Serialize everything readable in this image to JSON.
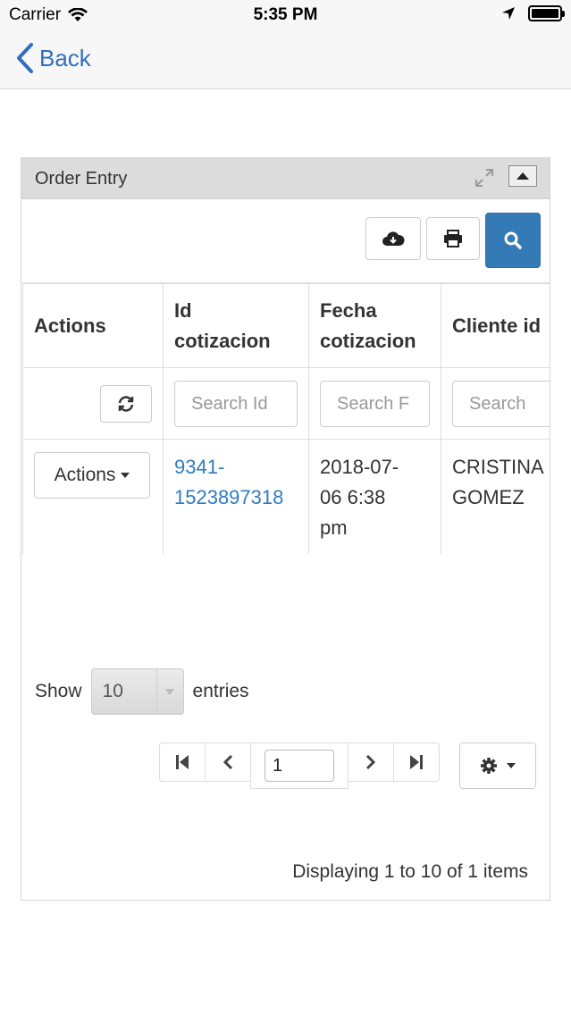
{
  "status_bar": {
    "carrier": "Carrier",
    "time": "5:35 PM"
  },
  "nav": {
    "back_label": "Back"
  },
  "panel": {
    "title": "Order Entry"
  },
  "table": {
    "headers": {
      "actions": "Actions",
      "id_line1": "Id",
      "id_line2": "cotizacion",
      "fecha_line1": "Fecha",
      "fecha_line2": "cotizacion",
      "cliente": "Cliente id"
    },
    "filters": {
      "id_placeholder": "Search Id",
      "fecha_placeholder": "Search F",
      "cliente_placeholder": "Search"
    },
    "rows": [
      {
        "actions_label": "Actions",
        "id_line1": "9341-",
        "id_line2": "1523897318",
        "fecha_line1": "2018-07-",
        "fecha_line2": "06 6:38",
        "fecha_line3": "pm",
        "cliente_line1": "CRISTINA",
        "cliente_line2": "GOMEZ"
      }
    ]
  },
  "footer": {
    "show_label": "Show",
    "page_size": "10",
    "entries_label": "entries",
    "current_page": "1",
    "display_info": "Displaying 1 to 10 of 1 items"
  },
  "colors": {
    "primary": "#337ab7",
    "link": "#2f7bc0",
    "ios_blue": "#2f6fbd"
  }
}
